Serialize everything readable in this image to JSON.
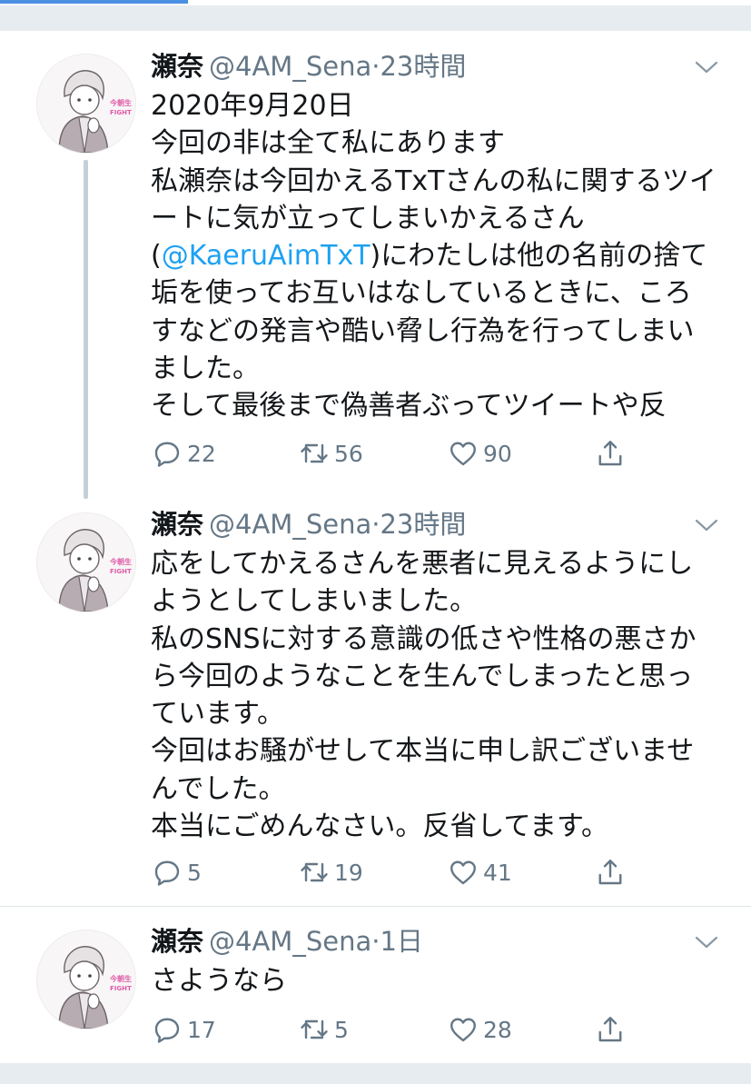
{
  "colors": {
    "link": "#1da1f2",
    "secondary_text": "#657786",
    "primary_text": "#14171a",
    "background": "#e6ecf0",
    "progress": "#4a90e2"
  },
  "page_load_progress": 0.25,
  "tweets": [
    {
      "name": "瀬奈",
      "handle": "@4AM_Sena",
      "dot": "·",
      "time": "23時間",
      "menu_icon": "chevron-down-icon",
      "lines": [
        {
          "text": "2020年9月20日"
        },
        {
          "text": "今回の非は全て私にあります"
        },
        {
          "text": "私瀬奈は今回かえるTxTさんの私に関するツイ"
        },
        {
          "text": "ートに気が立ってしまいかえるさん"
        },
        {
          "pre": "(",
          "mention": "@KaeruAimTxT",
          "post": ")にわたしは他の名前の捨て"
        },
        {
          "text": "垢を使ってお互いはなしているときに、ころ"
        },
        {
          "text": "すなどの発言や酷い脅し行為を行ってしまい"
        },
        {
          "text": "ました。"
        },
        {
          "text": "そして最後まで偽善者ぶってツイートや反"
        }
      ],
      "replies": "22",
      "retweets": "56",
      "likes": "90"
    },
    {
      "name": "瀬奈",
      "handle": "@4AM_Sena",
      "dot": "·",
      "time": "23時間",
      "menu_icon": "chevron-down-icon",
      "lines": [
        {
          "text": "応をしてかえるさんを悪者に見えるようにし"
        },
        {
          "text": "ようとしてしまいました。"
        },
        {
          "text": "私のSNSに対する意識の低さや性格の悪さか"
        },
        {
          "text": "ら今回のようなことを生んでしまったと思っ"
        },
        {
          "text": "ています。"
        },
        {
          "text": "今回はお騒がせして本当に申し訳ございませ"
        },
        {
          "text": "んでした。"
        },
        {
          "text": "本当にごめんなさい。反省してます。"
        }
      ],
      "replies": "5",
      "retweets": "19",
      "likes": "41"
    },
    {
      "name": "瀬奈",
      "handle": "@4AM_Sena",
      "dot": "·",
      "time": "1日",
      "menu_icon": "chevron-down-icon",
      "lines": [
        {
          "text": "さようなら"
        }
      ],
      "replies": "17",
      "retweets": "5",
      "likes": "28"
    }
  ],
  "avatar": {
    "badge_line1": "今朝生",
    "badge_line2": "FIGHT",
    "badge_color": "#e05aa8"
  },
  "icons": {
    "reply": "reply-icon",
    "retweet": "retweet-icon",
    "like": "like-icon",
    "share": "share-icon"
  }
}
